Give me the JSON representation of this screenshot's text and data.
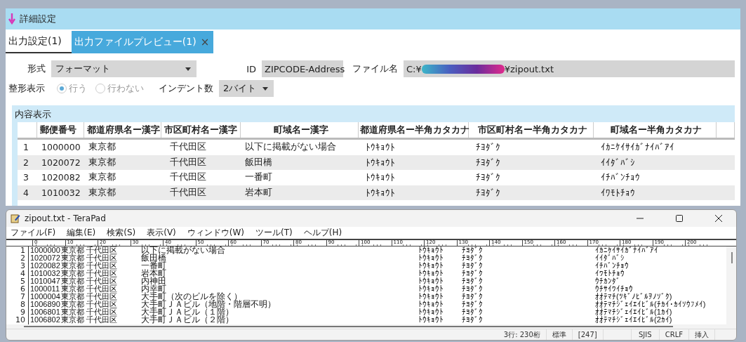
{
  "settings_window": {
    "title": "詳細設定",
    "tabs": [
      {
        "label": "出力設定(1)",
        "selected": false,
        "closable": false
      },
      {
        "label": "出力ファイルプレビュー(1)",
        "selected": true,
        "closable": true
      }
    ],
    "close_tab_glyph": "×",
    "format": {
      "label": "形式",
      "value": "フォーマット"
    },
    "id": {
      "label": "ID",
      "value": "ZIPCODE-Address"
    },
    "file_name": {
      "label": "ファイル名",
      "value_prefix": "C:¥",
      "value_suffix": "¥zipout.txt"
    },
    "pretty_print": {
      "label": "整形表示",
      "options": [
        {
          "label": "行う",
          "selected": true
        },
        {
          "label": "行わない",
          "selected": false
        }
      ]
    },
    "indent": {
      "label": "インデント数",
      "value": "2バイト"
    },
    "content_section": {
      "title": "内容表示"
    },
    "table": {
      "columns": [
        "",
        "郵便番号",
        "都道府県名ー漢字",
        "市区町村名ー漢字",
        "町域名ー漢字",
        "都道府県名ー半角カタカナ",
        "市区町村名ー半角カタカナ",
        "町域名ー半角カタカナ"
      ],
      "rows": [
        [
          "1",
          "1000000",
          "東京都",
          "千代田区",
          "以下に掲載がない場合",
          "ﾄｳｷｮｳﾄ",
          "ﾁﾖﾀﾞｸ",
          "ｲｶﾆｹｲｻｲｶﾞﾅｲﾊﾞｱｲ"
        ],
        [
          "2",
          "1020072",
          "東京都",
          "千代田区",
          "飯田橋",
          "ﾄｳｷｮｳﾄ",
          "ﾁﾖﾀﾞｸ",
          "ｲｲﾀﾞﾊﾞｼ"
        ],
        [
          "3",
          "1020082",
          "東京都",
          "千代田区",
          "一番町",
          "ﾄｳｷｮｳﾄ",
          "ﾁﾖﾀﾞｸ",
          "ｲﾁﾊﾞﾝﾁｮｳ"
        ],
        [
          "4",
          "1010032",
          "東京都",
          "千代田区",
          "岩本町",
          "ﾄｳｷｮｳﾄ",
          "ﾁﾖﾀﾞｸ",
          "ｲﾜﾓﾄﾁｮｳ"
        ]
      ]
    }
  },
  "editor_window": {
    "title": "zipout.txt - TeraPad",
    "menu": [
      "ファイル(F)",
      "編集(E)",
      "検索(S)",
      "表示(V)",
      "ウィンドウ(W)",
      "ツール(T)",
      "ヘルプ(H)"
    ],
    "ruler": [
      "0",
      "10",
      "20",
      "30",
      "40",
      "50",
      "60",
      "70",
      "80",
      "90",
      "100",
      "110",
      "120",
      "130",
      "140",
      "150",
      "160",
      "170",
      "180",
      "190",
      "200"
    ],
    "lines": [
      {
        "number": "1",
        "zip": "1000000",
        "pref": "東京都",
        "city": "千代田区",
        "town": "以下に掲載がない場合",
        "pref_kana": "ﾄｳｷｮｳﾄ",
        "city_kana": "ﾁﾖﾀﾞｸ",
        "town_kana": "ｲｶﾆｹｲｻｲｶﾞﾅｲﾊﾞｱｲ"
      },
      {
        "number": "2",
        "zip": "1020072",
        "pref": "東京都",
        "city": "千代田区",
        "town": "飯田橋",
        "pref_kana": "ﾄｳｷｮｳﾄ",
        "city_kana": "ﾁﾖﾀﾞｸ",
        "town_kana": "ｲｲﾀﾞﾊﾞｼ"
      },
      {
        "number": "3",
        "zip": "1020082",
        "pref": "東京都",
        "city": "千代田区",
        "town": "一番町",
        "pref_kana": "ﾄｳｷｮｳﾄ",
        "city_kana": "ﾁﾖﾀﾞｸ",
        "town_kana": "ｲﾁﾊﾞﾝﾁｮｳ"
      },
      {
        "number": "4",
        "zip": "1010032",
        "pref": "東京都",
        "city": "千代田区",
        "town": "岩本町",
        "pref_kana": "ﾄｳｷｮｳﾄ",
        "city_kana": "ﾁﾖﾀﾞｸ",
        "town_kana": "ｲﾜﾓﾄﾁｮｳ"
      },
      {
        "number": "5",
        "zip": "1010047",
        "pref": "東京都",
        "city": "千代田区",
        "town": "内神田",
        "pref_kana": "ﾄｳｷｮｳﾄ",
        "city_kana": "ﾁﾖﾀﾞｸ",
        "town_kana": "ｳﾁｶﾝﾀﾞ"
      },
      {
        "number": "6",
        "zip": "1000011",
        "pref": "東京都",
        "city": "千代田区",
        "town": "内幸町",
        "pref_kana": "ﾄｳｷｮｳﾄ",
        "city_kana": "ﾁﾖﾀﾞｸ",
        "town_kana": "ｳﾁｻｲﾜｲﾁｮｳ"
      },
      {
        "number": "7",
        "zip": "1000004",
        "pref": "東京都",
        "city": "千代田区",
        "town": "大手町（次のビルを除く）",
        "pref_kana": "ﾄｳｷｮｳﾄ",
        "city_kana": "ﾁﾖﾀﾞｸ",
        "town_kana": "ｵｵﾃﾏﾁ(ﾂｷﾞﾉﾋﾞﾙｦﾉｿﾞｸ)"
      },
      {
        "number": "8",
        "zip": "1006890",
        "pref": "東京都",
        "city": "千代田区",
        "town": "大手町ＪＡビル（地階・階層不明）",
        "pref_kana": "ﾄｳｷｮｳﾄ",
        "city_kana": "ﾁﾖﾀﾞｸ",
        "town_kana": "ｵｵﾃﾏﾁｼﾞｪｲｴｲﾋﾞﾙ(ﾁｶｲ･ｶｲｿｳﾌﾒｲ)"
      },
      {
        "number": "9",
        "zip": "1006801",
        "pref": "東京都",
        "city": "千代田区",
        "town": "大手町ＪＡビル（１階）",
        "pref_kana": "ﾄｳｷｮｳﾄ",
        "city_kana": "ﾁﾖﾀﾞｸ",
        "town_kana": "ｵｵﾃﾏﾁｼﾞｪｲｴｲﾋﾞﾙ(1ｶｲ)"
      },
      {
        "number": "10",
        "zip": "1006802",
        "pref": "東京都",
        "city": "千代田区",
        "town": "大手町ＪＡビル（２階）",
        "pref_kana": "ﾄｳｷｮｳﾄ",
        "city_kana": "ﾁﾖﾀﾞｸ",
        "town_kana": "ｵｵﾃﾏﾁｼﾞｪｲｴｲﾋﾞﾙ(2ｶｲ)"
      }
    ],
    "status_bar": [
      "3行: 230桁",
      "標準",
      "[247]",
      "SJIS",
      "CRLF",
      "挿入"
    ]
  }
}
